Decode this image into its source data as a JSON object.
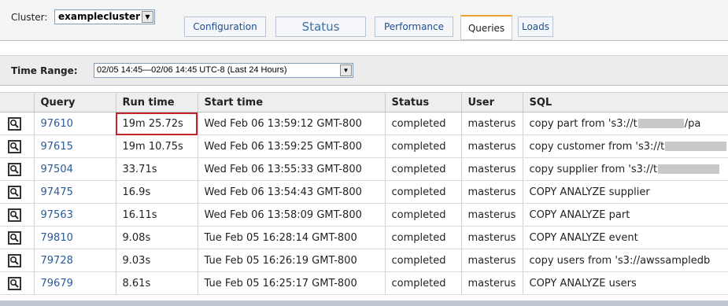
{
  "header": {
    "cluster_label": "Cluster:",
    "cluster_value": "examplecluster",
    "tabs": [
      {
        "label": "Configuration",
        "active": false
      },
      {
        "label": "Status",
        "active": false
      },
      {
        "label": "Performance",
        "active": false
      },
      {
        "label": "Queries",
        "active": true
      },
      {
        "label": "Loads",
        "active": false
      }
    ]
  },
  "time_range": {
    "label": "Time Range:",
    "value": "02/05 14:45—02/06 14:45 UTC-8 (Last 24 Hours)"
  },
  "table": {
    "columns": [
      "",
      "Query",
      "Run time",
      "Start time",
      "Status",
      "User",
      "SQL"
    ],
    "rows": [
      {
        "query": "97610",
        "run_time": "19m 25.72s",
        "start_time": "Wed Feb 06 13:59:12 GMT-800",
        "status": "completed",
        "user": "masterus",
        "sql_before": "copy part from 's3://t",
        "sql_after": "/pa",
        "redacted": true,
        "highlighted": true
      },
      {
        "query": "97615",
        "run_time": "19m 10.75s",
        "start_time": "Wed Feb 06 13:59:25 GMT-800",
        "status": "completed",
        "user": "masterus",
        "sql_before": "copy customer from 's3://t",
        "sql_after": "",
        "redacted": true,
        "highlighted": false
      },
      {
        "query": "97504",
        "run_time": "33.71s",
        "start_time": "Wed Feb 06 13:55:33 GMT-800",
        "status": "completed",
        "user": "masterus",
        "sql_before": "copy supplier from 's3://t",
        "sql_after": "",
        "redacted": true,
        "highlighted": false
      },
      {
        "query": "97475",
        "run_time": "16.9s",
        "start_time": "Wed Feb 06 13:54:43 GMT-800",
        "status": "completed",
        "user": "masterus",
        "sql_before": "COPY ANALYZE supplier",
        "sql_after": "",
        "redacted": false,
        "highlighted": false
      },
      {
        "query": "97563",
        "run_time": "16.11s",
        "start_time": "Wed Feb 06 13:58:09 GMT-800",
        "status": "completed",
        "user": "masterus",
        "sql_before": "COPY ANALYZE part",
        "sql_after": "",
        "redacted": false,
        "highlighted": false
      },
      {
        "query": "79810",
        "run_time": "9.08s",
        "start_time": "Tue Feb 05 16:28:14 GMT-800",
        "status": "completed",
        "user": "masterus",
        "sql_before": "COPY ANALYZE event",
        "sql_after": "",
        "redacted": false,
        "highlighted": false
      },
      {
        "query": "79728",
        "run_time": "9.03s",
        "start_time": "Tue Feb 05 16:26:19 GMT-800",
        "status": "completed",
        "user": "masterus",
        "sql_before": "copy users from 's3://awssampledb",
        "sql_after": "",
        "redacted": false,
        "highlighted": false
      },
      {
        "query": "79679",
        "run_time": "8.61s",
        "start_time": "Tue Feb 05 16:25:17 GMT-800",
        "status": "completed",
        "user": "masterus",
        "sql_before": "COPY ANALYZE users",
        "sql_after": "",
        "redacted": false,
        "highlighted": false
      }
    ]
  },
  "icons": {
    "row_detail": "magnifier-icon",
    "dropdown": "dropdown-arrow-icon"
  },
  "colors": {
    "link": "#2a5a98",
    "highlight_box": "#c0242a",
    "active_tab_accent": "#f0a030"
  }
}
